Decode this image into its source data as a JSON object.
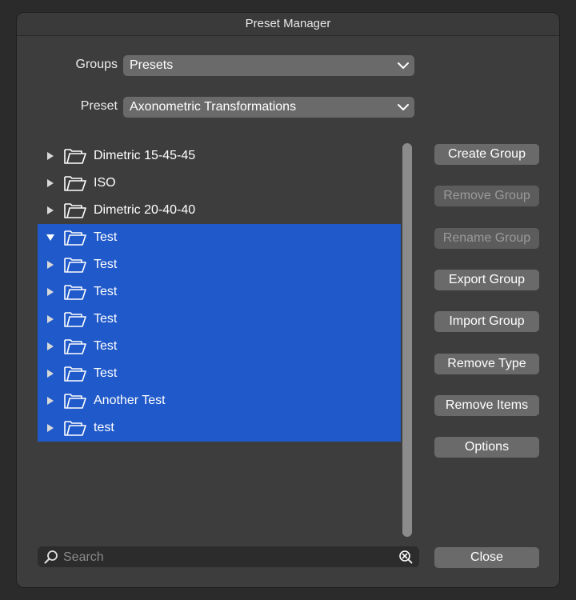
{
  "window": {
    "title": "Preset Manager"
  },
  "groups": {
    "label": "Groups",
    "value": "Presets"
  },
  "preset": {
    "label": "Preset",
    "value": "Axonometric Transformations"
  },
  "tree": [
    {
      "label": "Dimetric 15-45-45",
      "expanded": false,
      "selected": false
    },
    {
      "label": "ISO",
      "expanded": false,
      "selected": false
    },
    {
      "label": "Dimetric 20-40-40",
      "expanded": false,
      "selected": false
    },
    {
      "label": "Test",
      "expanded": true,
      "selected": true
    },
    {
      "label": "Test",
      "expanded": false,
      "selected": true
    },
    {
      "label": "Test",
      "expanded": false,
      "selected": true
    },
    {
      "label": "Test",
      "expanded": false,
      "selected": true
    },
    {
      "label": "Test",
      "expanded": false,
      "selected": true
    },
    {
      "label": "Test",
      "expanded": false,
      "selected": true
    },
    {
      "label": "Another Test",
      "expanded": false,
      "selected": true
    },
    {
      "label": "test",
      "expanded": false,
      "selected": true
    }
  ],
  "buttons": {
    "create_group": "Create Group",
    "remove_group": "Remove Group",
    "rename_group": "Rename Group",
    "export_group": "Export Group",
    "import_group": "Import Group",
    "remove_type": "Remove Type",
    "remove_items": "Remove Items",
    "options": "Options",
    "close": "Close"
  },
  "search": {
    "placeholder": "Search",
    "value": ""
  },
  "colors": {
    "selection": "#2059c9",
    "panel": "#3d3d3d",
    "button": "#6a6a6a"
  }
}
